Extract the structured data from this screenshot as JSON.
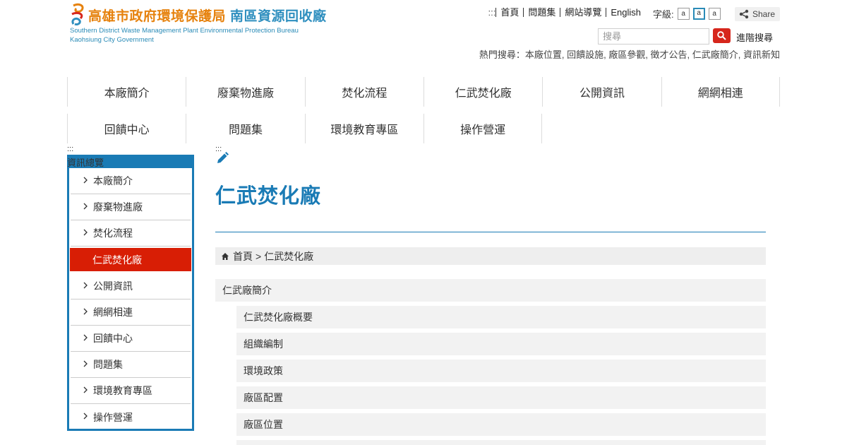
{
  "header": {
    "title_bureau": "高雄市政府環境保護局",
    "title_plant": "南區資源回收廠",
    "subtitle_line1": "Southern District Waste Management Plant Environmental Protection Bureau",
    "subtitle_line2": "Kaohsiung City Government"
  },
  "toplinks": {
    "accesskey": ":::",
    "items": [
      "首頁",
      "問題集",
      "網站導覽",
      "English"
    ],
    "fontsize_label": "字級:",
    "fontsize_options": [
      "a",
      "a",
      "a"
    ],
    "share_label": "Share"
  },
  "search": {
    "placeholder": "搜尋",
    "advanced_label": "進階搜尋",
    "hot_label": "熱門搜尋：",
    "hot_terms": "本廠位置, 回饋設施, 廠區參觀, 徵才公告, 仁武廠簡介, 資訊新知"
  },
  "nav": {
    "row1": [
      "本廠簡介",
      "廢棄物進廠",
      "焚化流程",
      "仁武焚化廠",
      "公開資訊",
      "網網相連"
    ],
    "row2": [
      "回饋中心",
      "問題集",
      "環境教育專區",
      "操作營運"
    ]
  },
  "sidebar": {
    "accesskey": ":::",
    "title": "資訊總覽",
    "items": [
      "本廠簡介",
      "廢棄物進廠",
      "焚化流程",
      "仁武焚化廠",
      "公開資訊",
      "網網相連",
      "回饋中心",
      "問題集",
      "環境教育專區",
      "操作營運"
    ],
    "active_index": 3
  },
  "content": {
    "accesskey": ":::",
    "title": "仁武焚化廠",
    "breadcrumb_home": "首頁",
    "breadcrumb_sep": ">",
    "breadcrumb_current": "仁武焚化廠",
    "section_title": "仁武廠簡介",
    "subitems": [
      "仁武焚化廠概要",
      "組織編制",
      "環境政策",
      "廠區配置",
      "廠區位置"
    ]
  },
  "colors": {
    "accent_blue": "#1a7bb5",
    "active_red": "#d81e05",
    "search_red": "#d6261c",
    "logo_orange": "#e6820e"
  }
}
